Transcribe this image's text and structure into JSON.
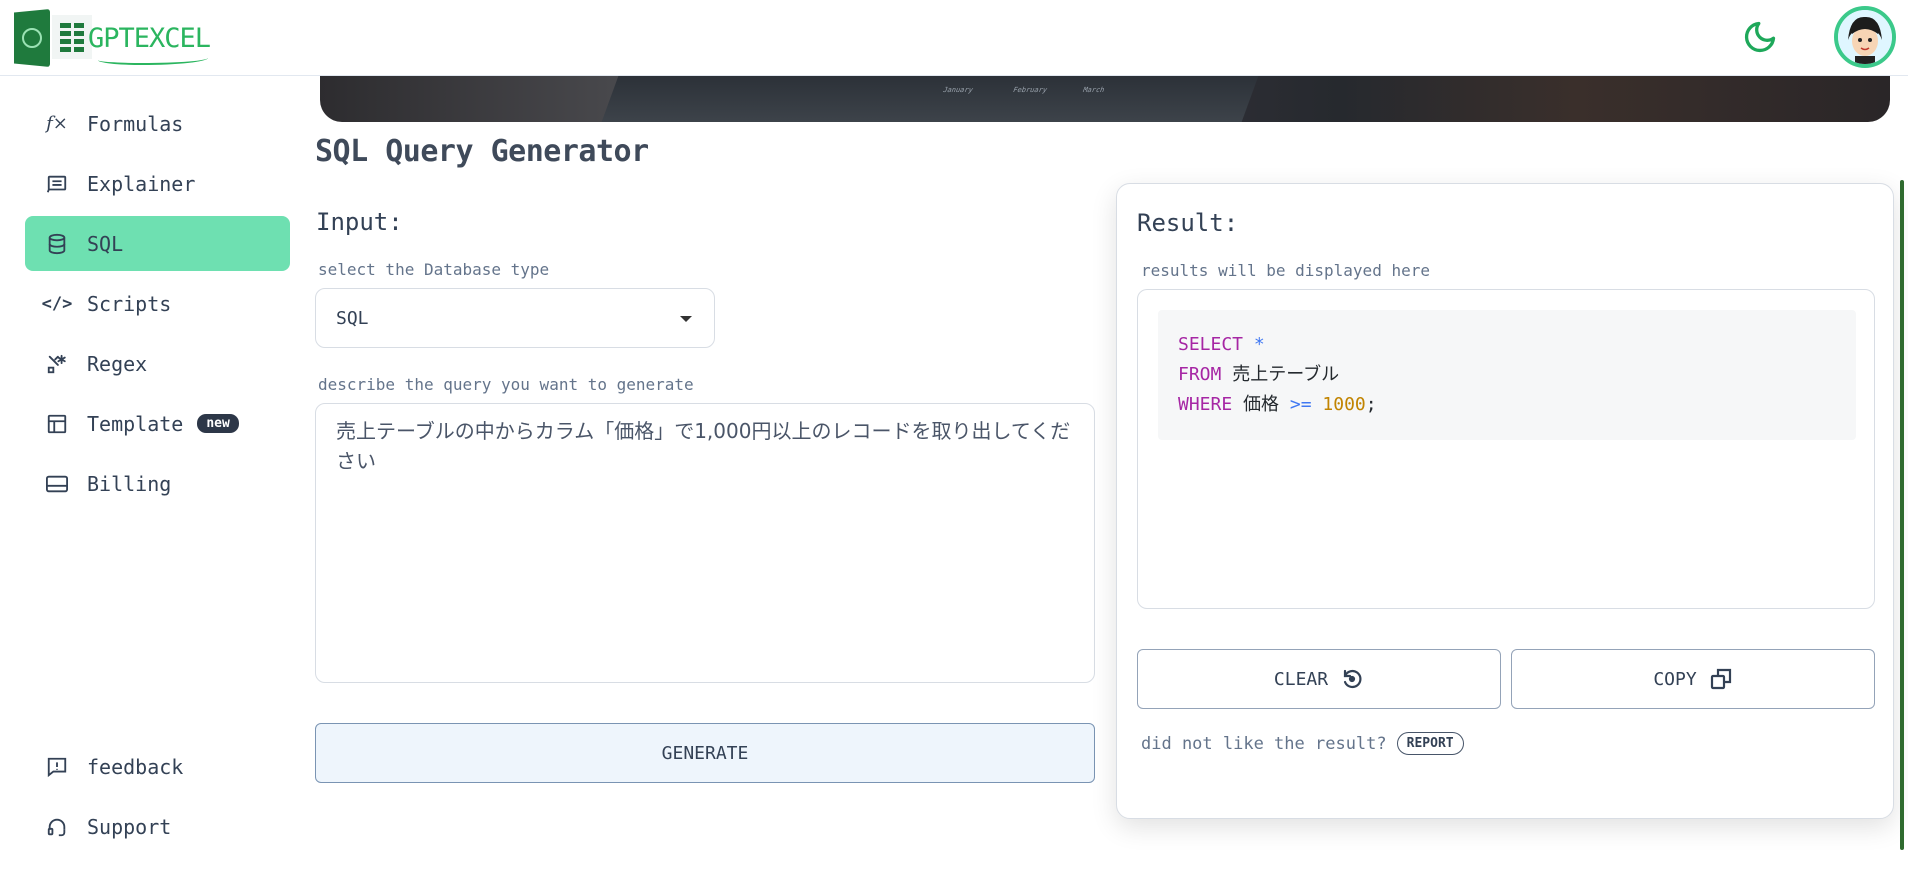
{
  "brand": {
    "name": "GPTEXCEL",
    "color": "#2bb55f"
  },
  "sidebar": {
    "items": [
      {
        "label": "Formulas",
        "icon": "function-icon",
        "active": false
      },
      {
        "label": "Explainer",
        "icon": "list-doc-icon",
        "active": false
      },
      {
        "label": "SQL",
        "icon": "database-icon",
        "active": true
      },
      {
        "label": "Scripts",
        "icon": "code-icon",
        "active": false
      },
      {
        "label": "Regex",
        "icon": "regex-icon",
        "active": false
      },
      {
        "label": "Template",
        "icon": "table-icon",
        "active": false,
        "badge": "new"
      },
      {
        "label": "Billing",
        "icon": "card-icon",
        "active": false
      }
    ],
    "bottom": [
      {
        "label": "feedback",
        "icon": "feedback-icon"
      },
      {
        "label": "Support",
        "icon": "headset-icon"
      }
    ],
    "active_color": "#6ee0b1"
  },
  "page": {
    "title": "SQL Query Generator"
  },
  "input": {
    "heading": "Input:",
    "db_label": "select the Database type",
    "db_value": "SQL",
    "query_label": "describe the query you want to generate",
    "query_value": "売上テーブルの中からカラム「価格」で1,000円以上のレコードを取り出してください",
    "generate_label": "GENERATE"
  },
  "result": {
    "heading": "Result:",
    "hint": "results will be displayed here",
    "code": {
      "line1_kw": "SELECT",
      "line1_rest": "*",
      "line2_kw": "FROM",
      "line2_rest": "売上テーブル",
      "line3_kw": "WHERE",
      "line3_col": "価格",
      "line3_op": ">=",
      "line3_num": "1000",
      "line3_end": ";"
    },
    "clear_label": "CLEAR",
    "copy_label": "COPY",
    "feedback_text": "did not like the result?",
    "report_label": "REPORT"
  }
}
